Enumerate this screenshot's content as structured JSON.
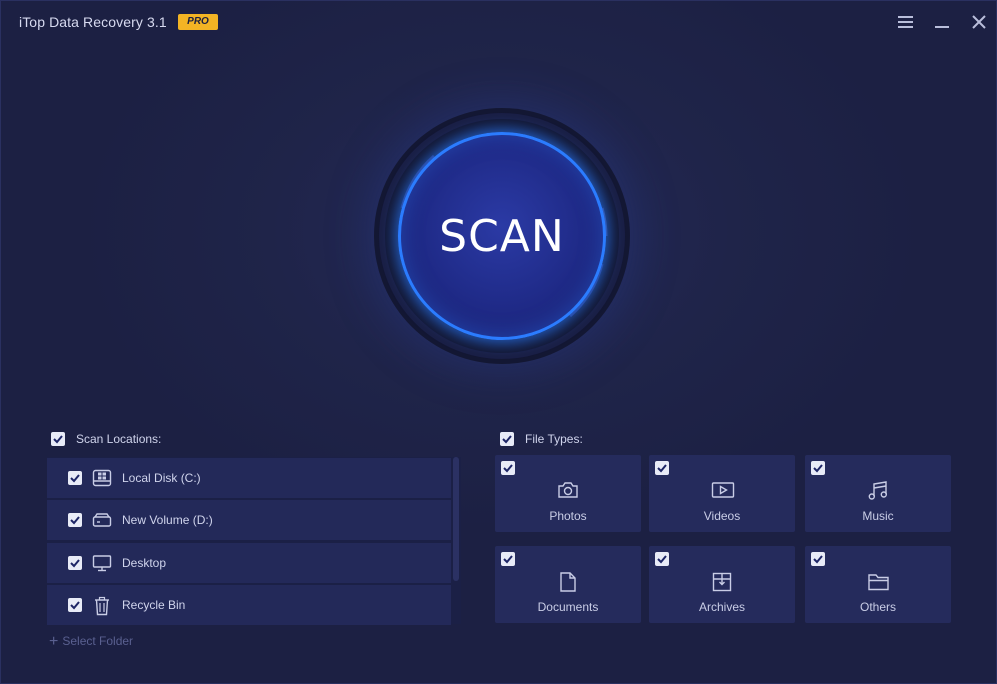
{
  "app": {
    "title": "iTop Data Recovery 3.1",
    "badge": "PRO"
  },
  "window_controls": {
    "menu_icon": "hamburger-menu-icon",
    "minimize_icon": "minimize-icon",
    "close_icon": "close-icon"
  },
  "scan_button": {
    "label": "SCAN",
    "ring_color": "#2b7cff"
  },
  "scan_locations": {
    "header": "Scan Locations:",
    "checked": true,
    "items": [
      {
        "label": "Local Disk (C:)",
        "icon": "windows-drive-icon",
        "checked": true
      },
      {
        "label": "New Volume (D:)",
        "icon": "drive-icon",
        "checked": true
      },
      {
        "label": "Desktop",
        "icon": "monitor-icon",
        "checked": true
      },
      {
        "label": "Recycle Bin",
        "icon": "trash-icon",
        "checked": true
      }
    ],
    "select_folder": "Select Folder"
  },
  "file_types": {
    "header": "File Types:",
    "checked": true,
    "items": [
      {
        "label": "Photos",
        "icon": "camera-icon",
        "checked": true
      },
      {
        "label": "Videos",
        "icon": "video-icon",
        "checked": true
      },
      {
        "label": "Music",
        "icon": "music-note-icon",
        "checked": true
      },
      {
        "label": "Documents",
        "icon": "document-icon",
        "checked": true
      },
      {
        "label": "Archives",
        "icon": "archive-box-icon",
        "checked": true
      },
      {
        "label": "Others",
        "icon": "folder-icon",
        "checked": true
      }
    ]
  },
  "colors": {
    "background": "#1d2245",
    "accent": "#2b7cff",
    "badge": "#f3b424"
  }
}
